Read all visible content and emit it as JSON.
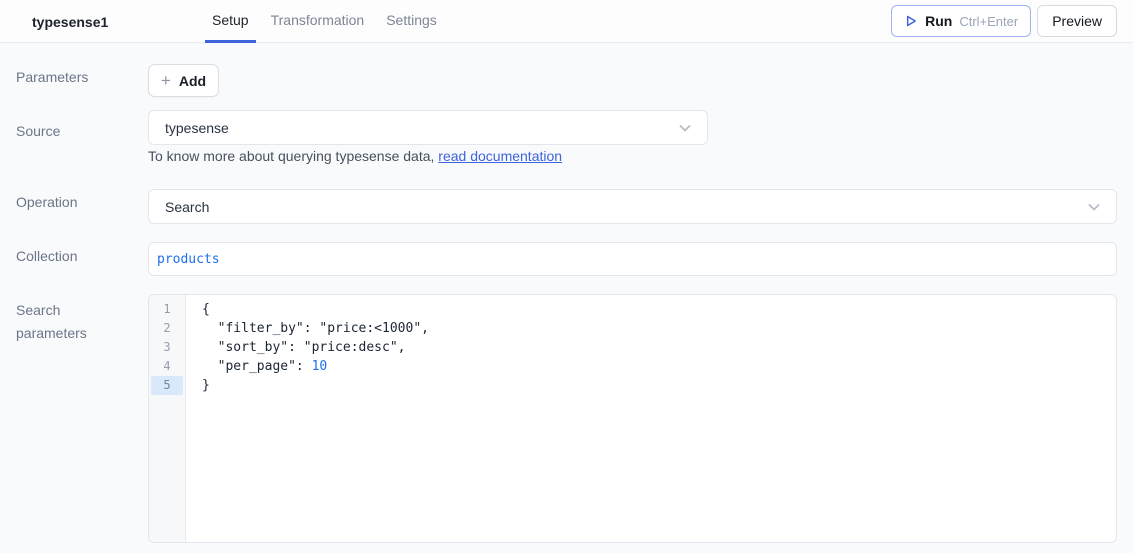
{
  "header": {
    "title": "typesense1",
    "tabs": [
      {
        "label": "Setup",
        "active": true
      },
      {
        "label": "Transformation",
        "active": false
      },
      {
        "label": "Settings",
        "active": false
      }
    ],
    "run_label": "Run",
    "run_shortcut": "Ctrl+Enter",
    "preview_label": "Preview"
  },
  "form": {
    "parameters": {
      "label": "Parameters",
      "add_label": "Add"
    },
    "source": {
      "label": "Source",
      "value": "typesense",
      "helper_prefix": "To know more about querying typesense data, ",
      "helper_link": "read documentation"
    },
    "operation": {
      "label": "Operation",
      "value": "Search"
    },
    "collection": {
      "label": "Collection",
      "value": "products"
    },
    "search_parameters": {
      "label_line1": "Search",
      "label_line2": "parameters",
      "active_line": 5,
      "code_lines": [
        {
          "n": "1",
          "active": false,
          "segs": [
            {
              "t": "{",
              "k": "plain"
            }
          ]
        },
        {
          "n": "2",
          "active": false,
          "segs": [
            {
              "t": "  \"filter_by\": \"price:<1000\",",
              "k": "plain"
            }
          ]
        },
        {
          "n": "3",
          "active": false,
          "segs": [
            {
              "t": "  \"sort_by\": \"price:desc\",",
              "k": "plain"
            }
          ]
        },
        {
          "n": "4",
          "active": false,
          "segs": [
            {
              "t": "  \"per_page\": ",
              "k": "plain"
            },
            {
              "t": "10",
              "k": "num"
            }
          ]
        },
        {
          "n": "5",
          "active": true,
          "segs": [
            {
              "t": "}",
              "k": "plain"
            }
          ]
        }
      ]
    }
  },
  "colors": {
    "accent_blue": "#3e63dd",
    "link_blue": "#3e63dd",
    "code_blue": "#1f6feb",
    "code_dark": "#1c2534",
    "label_gray": "#6b7587",
    "active_line_bg": "#d9e8fb"
  }
}
